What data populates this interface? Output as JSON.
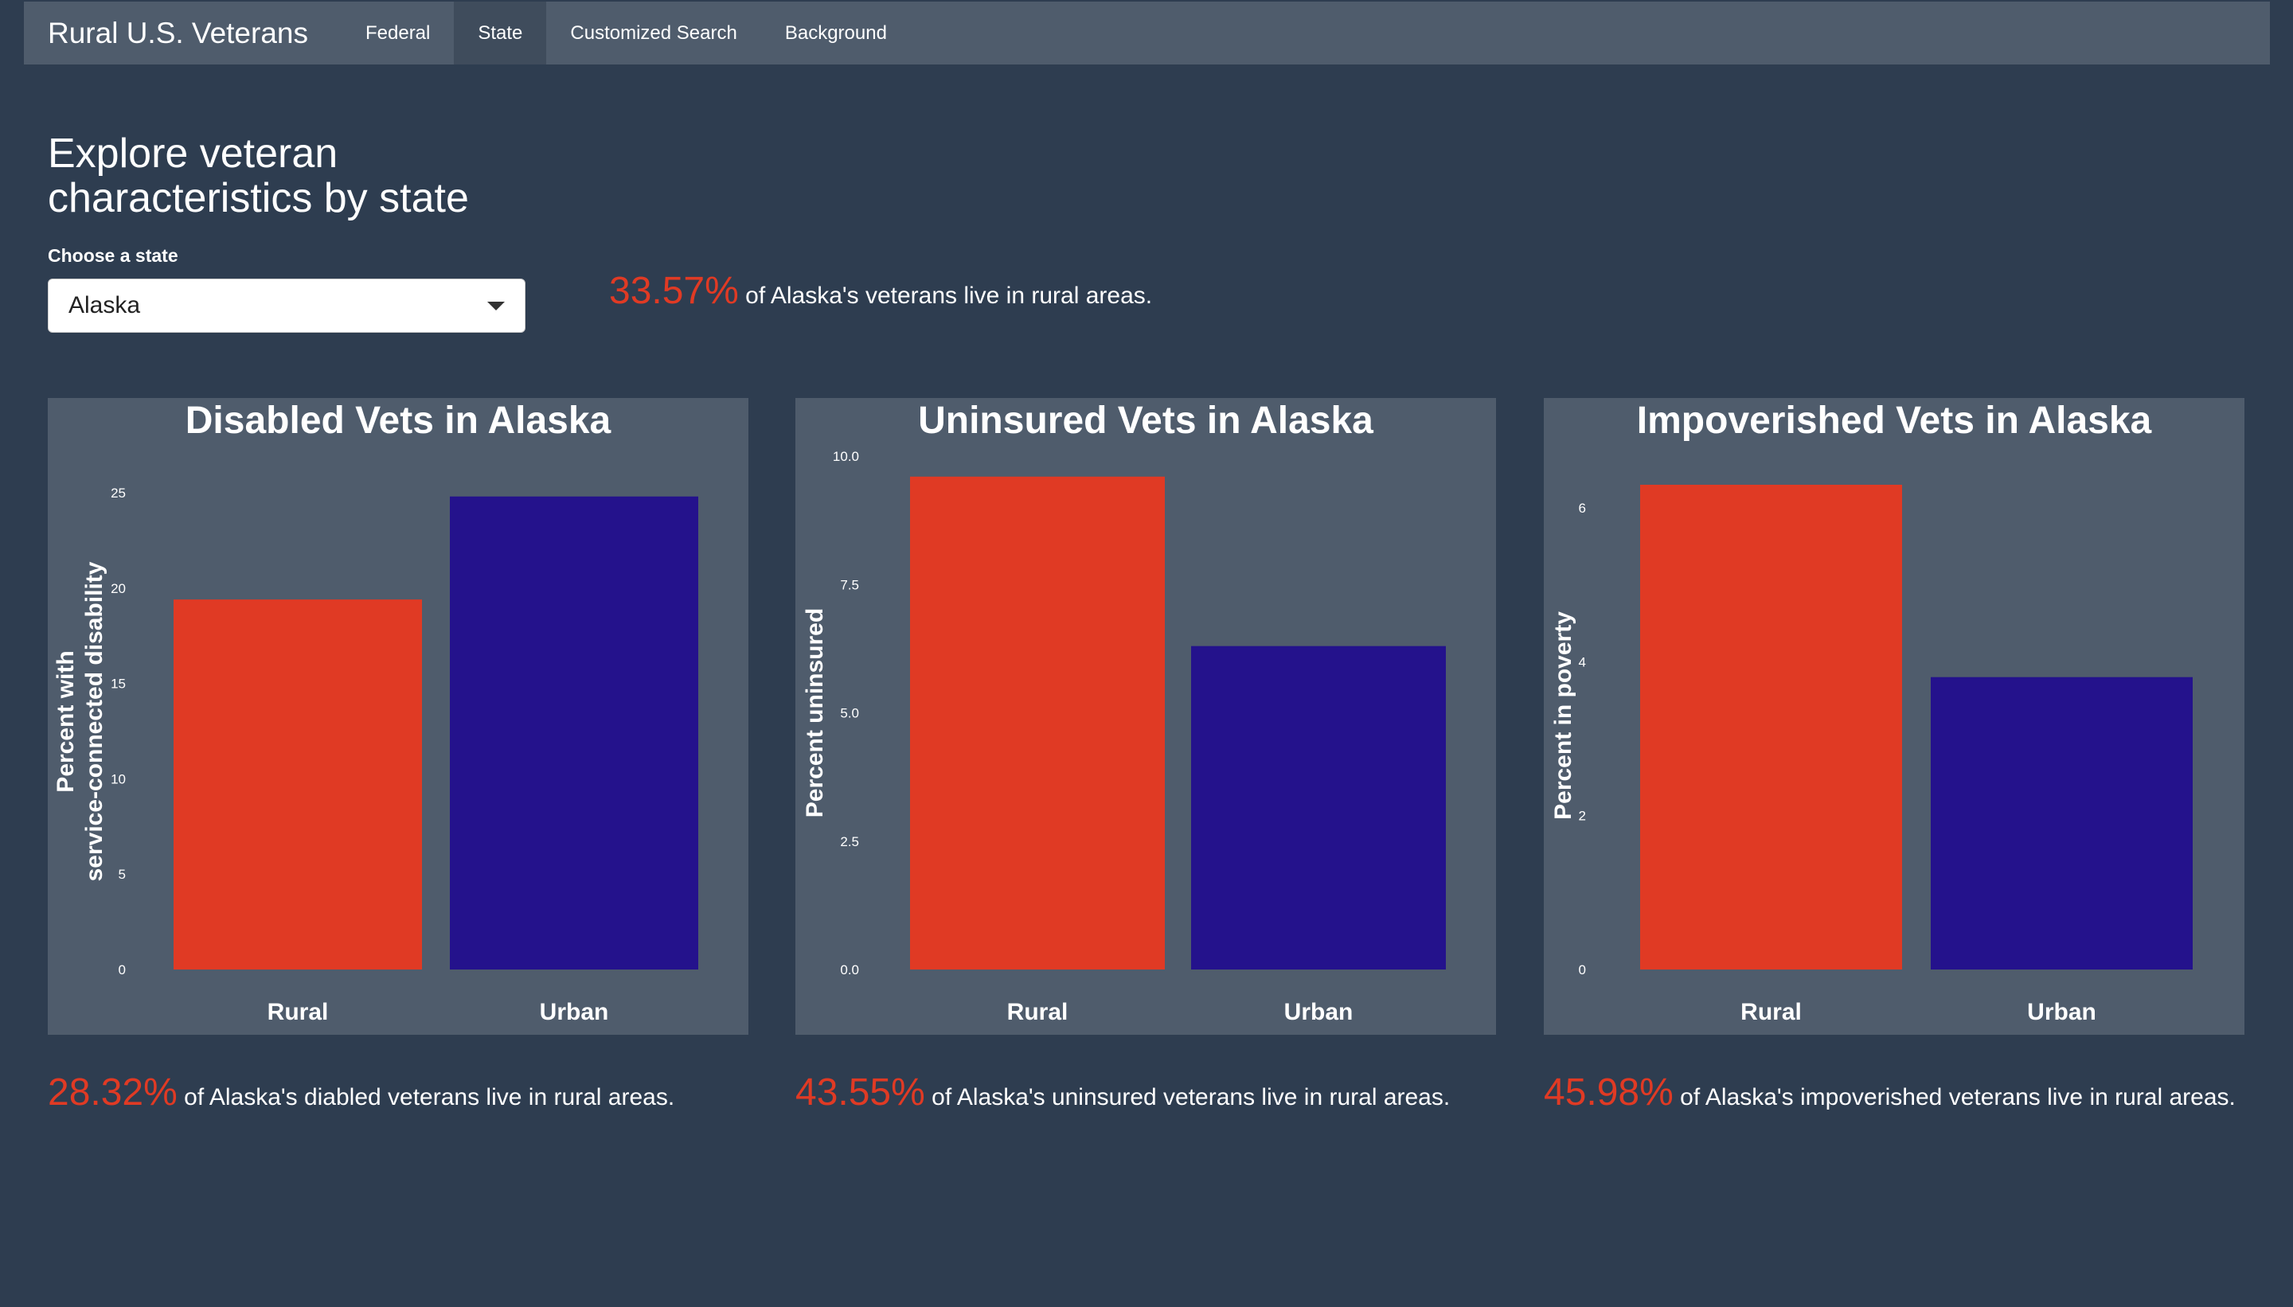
{
  "navbar": {
    "brand": "Rural U.S. Veterans",
    "items": [
      {
        "label": "Federal",
        "active": false
      },
      {
        "label": "State",
        "active": true
      },
      {
        "label": "Customized Search",
        "active": false
      },
      {
        "label": "Background",
        "active": false
      }
    ]
  },
  "page": {
    "title_line1": "Explore veteran",
    "title_line2": "characteristics by state",
    "state_label": "Choose a state",
    "state_value": "Alaska"
  },
  "headline": {
    "pct": "33.57%",
    "text": " of Alaska's veterans live in rural areas."
  },
  "colors": {
    "accent": "#e03a24",
    "rural_bar": "#e03a24",
    "urban_bar": "#24128c",
    "background": "#2e3d50",
    "panel": "#4f5c6c"
  },
  "chart_data": [
    {
      "type": "bar",
      "title": "Disabled Vets in Alaska",
      "ylabel_lines": [
        "Percent with",
        "service-connected disability"
      ],
      "categories": [
        "Rural",
        "Urban"
      ],
      "values": [
        19.4,
        24.8
      ],
      "ylim": [
        0,
        26
      ],
      "yticks": [
        0,
        5,
        10,
        15,
        20,
        25
      ],
      "ytick_labels": [
        "0",
        "5",
        "10",
        "15",
        "20",
        "25"
      ],
      "grid": false,
      "legend": "none"
    },
    {
      "type": "bar",
      "title": "Uninsured Vets in Alaska",
      "ylabel_lines": [
        "Percent uninsured"
      ],
      "categories": [
        "Rural",
        "Urban"
      ],
      "values": [
        9.6,
        6.3
      ],
      "ylim": [
        0,
        10
      ],
      "yticks": [
        0,
        2.5,
        5,
        7.5,
        10
      ],
      "ytick_labels": [
        "0.0",
        "2.5",
        "5.0",
        "7.5",
        "10.0"
      ],
      "grid": false,
      "legend": "none"
    },
    {
      "type": "bar",
      "title": "Impoverished Vets in Alaska",
      "ylabel_lines": [
        "Percent in poverty"
      ],
      "categories": [
        "Rural",
        "Urban"
      ],
      "values": [
        6.3,
        3.8
      ],
      "ylim": [
        0,
        6.6
      ],
      "yticks": [
        0,
        2,
        4,
        6
      ],
      "ytick_labels": [
        "0",
        "2",
        "4",
        "6"
      ],
      "grid": false,
      "legend": "none"
    }
  ],
  "stats": [
    {
      "pct": "28.32%",
      "text": " of Alaska's diabled veterans live in rural areas."
    },
    {
      "pct": "43.55%",
      "text": " of Alaska's uninsured veterans live in rural areas."
    },
    {
      "pct": "45.98%",
      "text": " of Alaska's impoverished veterans live in rural areas."
    }
  ]
}
